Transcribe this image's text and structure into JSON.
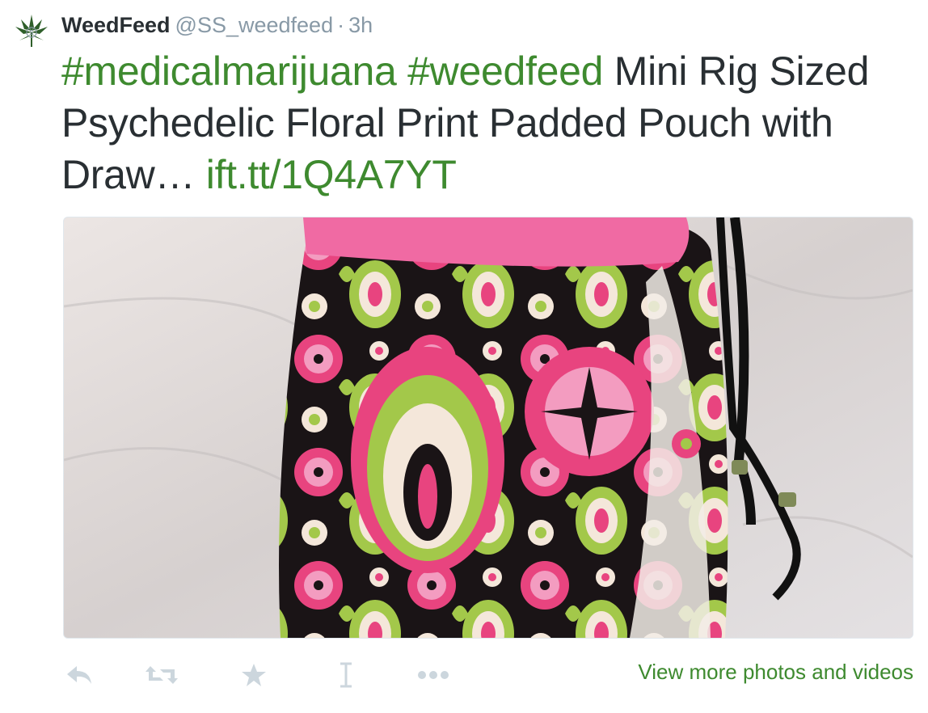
{
  "tweet": {
    "display_name": "WeedFeed",
    "handle": "@SS_weedfeed",
    "separator": "·",
    "time": "3h",
    "hashtag1": "#medicalmarijuana",
    "hashtag2": "#weedfeed",
    "body": "Mini Rig Sized Psychedelic Floral Print Padded Pouch with Draw…",
    "link": "ift.tt/1Q4A7YT"
  },
  "media": {
    "icon": "photo",
    "subject": "psychedelic floral print padded pouch with black drawstring"
  },
  "actions": {
    "icons": [
      "reply-icon",
      "retweet-icon",
      "favorite-icon",
      "cursor-icon",
      "more-icon"
    ],
    "more_link": "View more photos and videos"
  },
  "colors": {
    "link": "#3e8a2f",
    "muted": "#8899a6",
    "text": "#292f33"
  }
}
